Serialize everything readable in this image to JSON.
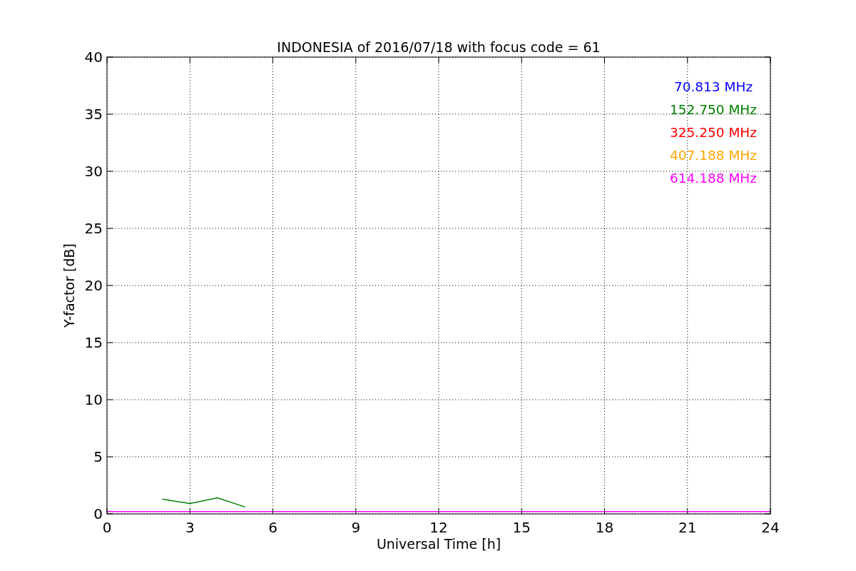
{
  "chart_data": {
    "type": "line",
    "title": "INDONESIA of 2016/07/18 with focus code = 61",
    "xlabel": "Universal Time [h]",
    "ylabel": "Y-factor [dB]",
    "x": [
      0,
      1,
      2,
      3,
      4,
      5,
      6,
      7,
      8,
      9,
      10,
      11,
      12,
      13,
      14,
      15,
      16,
      17,
      18,
      19,
      20,
      21,
      22,
      23,
      24
    ],
    "series": [
      {
        "name": "70.813 MHz",
        "color": "#0000ff",
        "values": [
          null,
          null,
          null,
          null,
          null,
          null,
          null,
          null,
          null,
          null,
          null,
          null,
          null,
          null,
          null,
          null,
          null,
          null,
          null,
          null,
          null,
          null,
          null,
          null,
          null
        ]
      },
      {
        "name": "152.750 MHz",
        "color": "#008000",
        "values": [
          null,
          null,
          1.3,
          0.9,
          1.4,
          0.6,
          null,
          null,
          null,
          null,
          null,
          null,
          null,
          null,
          null,
          null,
          null,
          null,
          null,
          null,
          null,
          null,
          null,
          null,
          null
        ]
      },
      {
        "name": "325.250 MHz",
        "color": "#ff0000",
        "values": [
          null,
          null,
          null,
          null,
          null,
          null,
          null,
          null,
          null,
          null,
          null,
          null,
          null,
          null,
          null,
          null,
          null,
          null,
          null,
          null,
          null,
          null,
          null,
          null,
          null
        ]
      },
      {
        "name": "407.188 MHz",
        "color": "#ffa500",
        "values": [
          null,
          null,
          null,
          null,
          null,
          null,
          null,
          null,
          null,
          null,
          null,
          null,
          null,
          null,
          null,
          null,
          null,
          null,
          null,
          null,
          null,
          null,
          null,
          null,
          null
        ]
      },
      {
        "name": "614.188 MHz",
        "color": "#ff00ff",
        "values": [
          0.2,
          0.2,
          0.2,
          0.2,
          0.2,
          0.2,
          0.2,
          0.2,
          0.2,
          0.2,
          0.2,
          0.2,
          0.2,
          0.2,
          0.2,
          0.2,
          0.2,
          0.2,
          0.2,
          0.2,
          0.2,
          0.2,
          0.2,
          0.2,
          0.2
        ]
      }
    ],
    "xlim": [
      0,
      24
    ],
    "ylim": [
      0,
      40
    ],
    "xticks": [
      0,
      3,
      6,
      9,
      12,
      15,
      18,
      21,
      24
    ],
    "yticks": [
      0,
      5,
      10,
      15,
      20,
      25,
      30,
      35,
      40
    ],
    "grid": true
  }
}
